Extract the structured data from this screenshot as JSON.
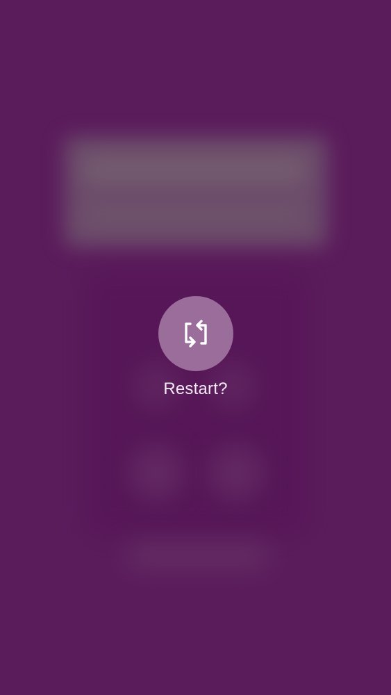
{
  "theme": {
    "background": "#5a1b5b",
    "button_fill": "#9a6d9b",
    "label_color": "#f4eaf4"
  },
  "restart_prompt": {
    "icon": "restart-icon",
    "label": "Restart?"
  }
}
